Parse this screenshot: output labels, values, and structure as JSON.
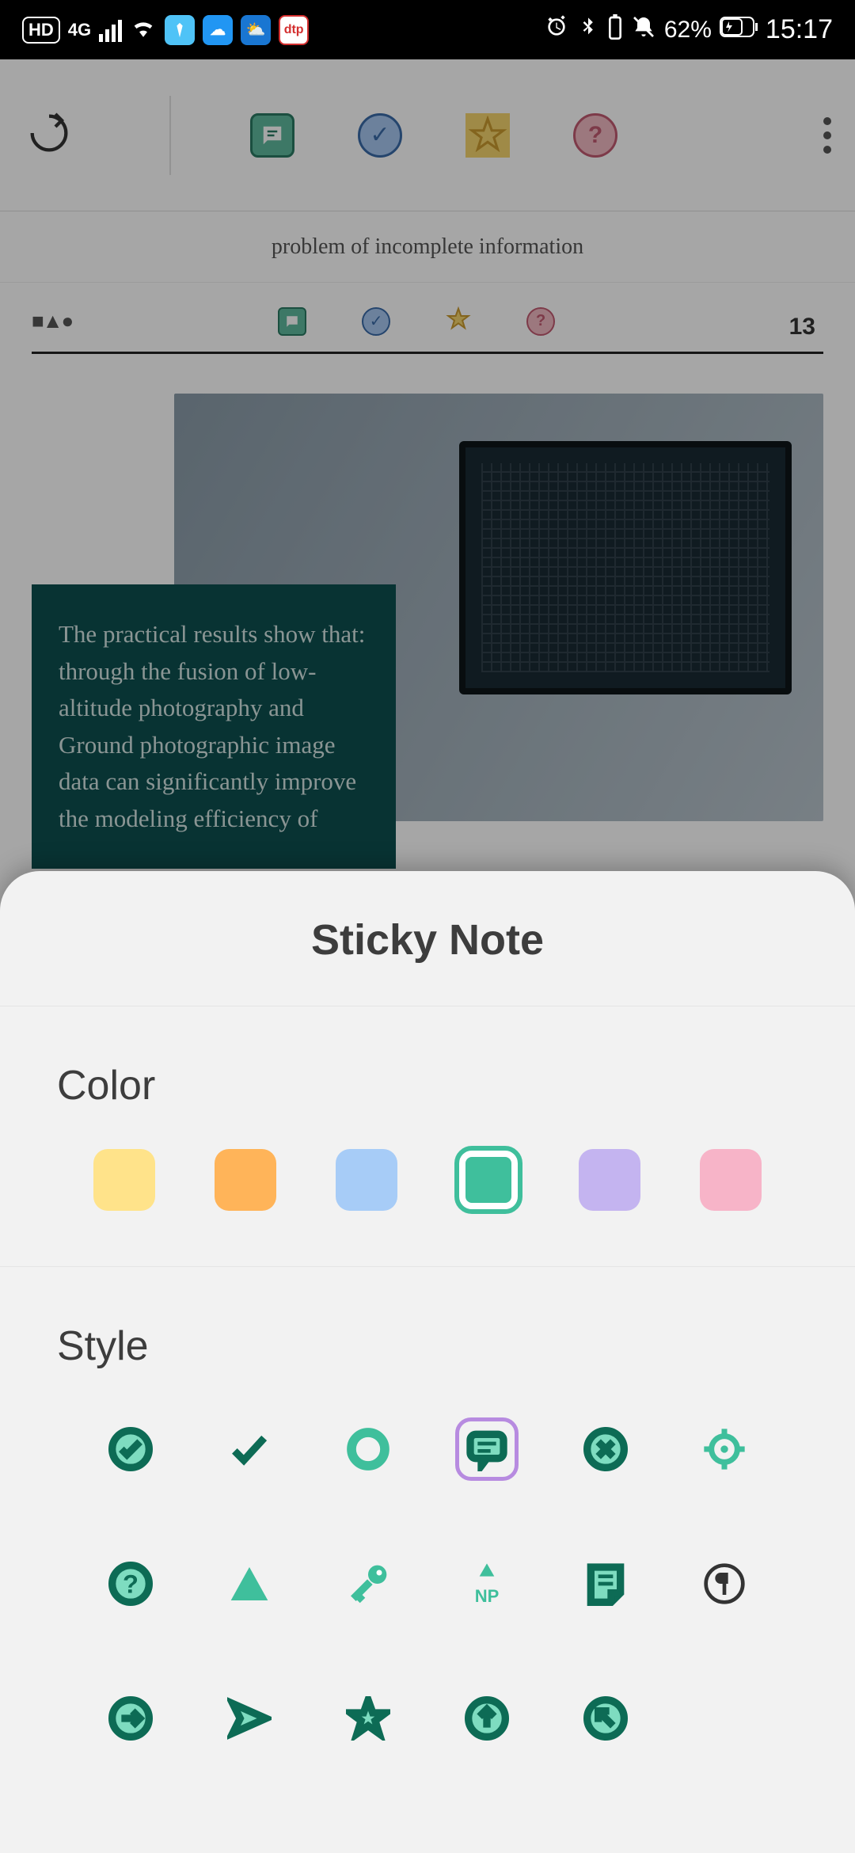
{
  "status": {
    "hd": "HD",
    "net": "4G",
    "app4": "dtp",
    "battery": "62%",
    "time": "15:17"
  },
  "doc": {
    "truncated_line": "problem of incomplete information",
    "page": "13",
    "callout": "The practical results show that: through the fusion of low-altitude photography and Ground photographic image data can significantly improve the modeling efficiency of"
  },
  "sheet": {
    "title": "Sticky Note",
    "color_label": "Color",
    "style_label": "Style",
    "np_label": "NP",
    "colors": [
      {
        "name": "yellow",
        "style": "background:#ffe38a"
      },
      {
        "name": "orange",
        "style": "background:#ffb459"
      },
      {
        "name": "blue",
        "style": "background:#a7ccf7"
      },
      {
        "name": "green",
        "style": "background:#62d0ae",
        "selected": true
      },
      {
        "name": "purple",
        "style": "background:#c4b4f0"
      },
      {
        "name": "pink",
        "style": "background:#f7b4c8"
      }
    ],
    "styles": [
      "check-filled",
      "check",
      "circle",
      "comment",
      "cross",
      "crosshair",
      "help",
      "triangle",
      "key",
      "new-paragraph",
      "note",
      "paragraph",
      "arrow-right-circle",
      "arrow-right",
      "star",
      "arrow-up",
      "arrow-upleft"
    ],
    "selected_style": "comment"
  }
}
